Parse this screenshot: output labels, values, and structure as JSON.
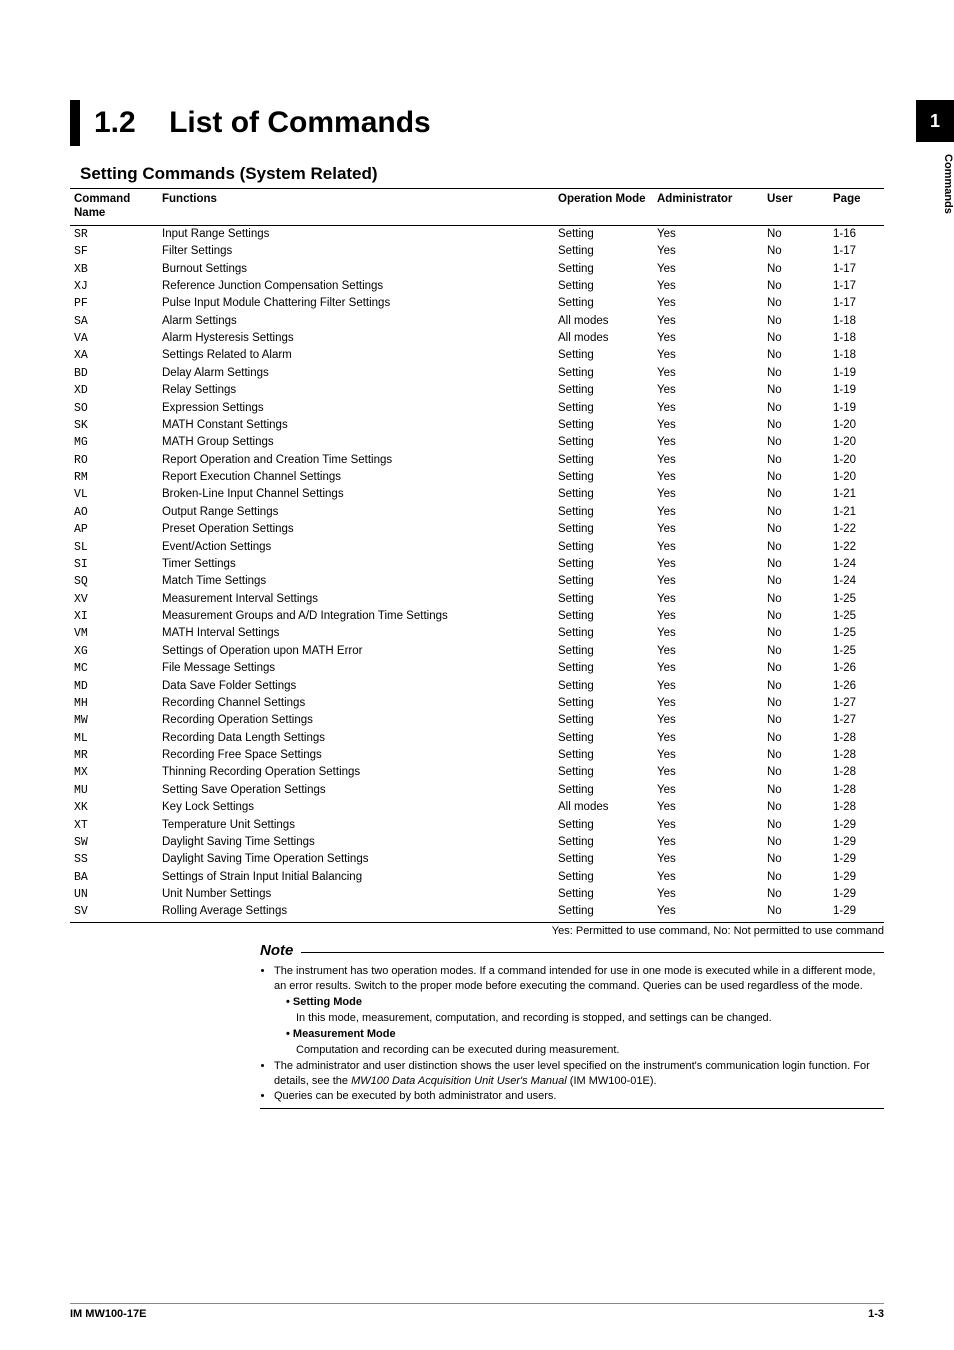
{
  "side_tab": "1",
  "side_label": "Commands",
  "section_num": "1.2",
  "section_title": "List of Commands",
  "subheading": "Setting Commands (System Related)",
  "th": {
    "cmd": "Command Name",
    "func": "Functions",
    "opmode": "Operation Mode",
    "admin": "Administrator",
    "user": "User",
    "page": "Page"
  },
  "rows": [
    {
      "cmd": "SR",
      "func": "Input Range Settings",
      "opmode": "Setting",
      "admin": "Yes",
      "user": "No",
      "page": "1-16"
    },
    {
      "cmd": "SF",
      "func": "Filter Settings",
      "opmode": "Setting",
      "admin": "Yes",
      "user": "No",
      "page": "1-17"
    },
    {
      "cmd": "XB",
      "func": "Burnout Settings",
      "opmode": "Setting",
      "admin": "Yes",
      "user": "No",
      "page": "1-17"
    },
    {
      "cmd": "XJ",
      "func": "Reference Junction Compensation Settings",
      "opmode": "Setting",
      "admin": "Yes",
      "user": "No",
      "page": "1-17"
    },
    {
      "cmd": "PF",
      "func": "Pulse Input Module Chattering Filter Settings",
      "opmode": "Setting",
      "admin": "Yes",
      "user": "No",
      "page": "1-17"
    },
    {
      "cmd": "SA",
      "func": "Alarm Settings",
      "opmode": "All modes",
      "admin": "Yes",
      "user": "No",
      "page": "1-18"
    },
    {
      "cmd": "VA",
      "func": "Alarm Hysteresis Settings",
      "opmode": "All modes",
      "admin": "Yes",
      "user": "No",
      "page": "1-18"
    },
    {
      "cmd": "XA",
      "func": "Settings Related to Alarm",
      "opmode": "Setting",
      "admin": "Yes",
      "user": "No",
      "page": "1-18"
    },
    {
      "cmd": "BD",
      "func": "Delay Alarm Settings",
      "opmode": "Setting",
      "admin": "Yes",
      "user": "No",
      "page": "1-19"
    },
    {
      "cmd": "XD",
      "func": "Relay Settings",
      "opmode": "Setting",
      "admin": "Yes",
      "user": "No",
      "page": "1-19"
    },
    {
      "cmd": "SO",
      "func": "Expression Settings",
      "opmode": "Setting",
      "admin": "Yes",
      "user": "No",
      "page": "1-19"
    },
    {
      "cmd": "SK",
      "func": "MATH Constant Settings",
      "opmode": "Setting",
      "admin": "Yes",
      "user": "No",
      "page": "1-20"
    },
    {
      "cmd": "MG",
      "func": "MATH Group Settings",
      "opmode": "Setting",
      "admin": "Yes",
      "user": "No",
      "page": "1-20"
    },
    {
      "cmd": "RO",
      "func": "Report Operation and Creation Time Settings",
      "opmode": "Setting",
      "admin": "Yes",
      "user": "No",
      "page": "1-20"
    },
    {
      "cmd": "RM",
      "func": "Report Execution Channel Settings",
      "opmode": "Setting",
      "admin": "Yes",
      "user": "No",
      "page": "1-20"
    },
    {
      "cmd": "VL",
      "func": "Broken-Line Input Channel Settings",
      "opmode": "Setting",
      "admin": "Yes",
      "user": "No",
      "page": "1-21"
    },
    {
      "cmd": "AO",
      "func": "Output Range Settings",
      "opmode": "Setting",
      "admin": "Yes",
      "user": "No",
      "page": "1-21"
    },
    {
      "cmd": "AP",
      "func": "Preset Operation Settings",
      "opmode": "Setting",
      "admin": "Yes",
      "user": "No",
      "page": "1-22"
    },
    {
      "cmd": "SL",
      "func": "Event/Action Settings",
      "opmode": "Setting",
      "admin": "Yes",
      "user": "No",
      "page": "1-22"
    },
    {
      "cmd": "SI",
      "func": "Timer Settings",
      "opmode": "Setting",
      "admin": "Yes",
      "user": "No",
      "page": "1-24"
    },
    {
      "cmd": "SQ",
      "func": "Match Time Settings",
      "opmode": "Setting",
      "admin": "Yes",
      "user": "No",
      "page": "1-24"
    },
    {
      "cmd": "XV",
      "func": "Measurement Interval Settings",
      "opmode": "Setting",
      "admin": "Yes",
      "user": "No",
      "page": "1-25"
    },
    {
      "cmd": "XI",
      "func": "Measurement Groups and A/D Integration Time Settings",
      "opmode": "Setting",
      "admin": "Yes",
      "user": "No",
      "page": "1-25"
    },
    {
      "cmd": "VM",
      "func": "MATH Interval Settings",
      "opmode": "Setting",
      "admin": "Yes",
      "user": "No",
      "page": "1-25"
    },
    {
      "cmd": "XG",
      "func": "Settings of Operation upon MATH Error",
      "opmode": "Setting",
      "admin": "Yes",
      "user": "No",
      "page": "1-25"
    },
    {
      "cmd": "MC",
      "func": "File Message Settings",
      "opmode": "Setting",
      "admin": "Yes",
      "user": "No",
      "page": "1-26"
    },
    {
      "cmd": "MD",
      "func": "Data Save Folder Settings",
      "opmode": "Setting",
      "admin": "Yes",
      "user": "No",
      "page": "1-26"
    },
    {
      "cmd": "MH",
      "func": "Recording Channel Settings",
      "opmode": "Setting",
      "admin": "Yes",
      "user": "No",
      "page": "1-27"
    },
    {
      "cmd": "MW",
      "func": "Recording Operation Settings",
      "opmode": "Setting",
      "admin": "Yes",
      "user": "No",
      "page": "1-27"
    },
    {
      "cmd": "ML",
      "func": "Recording Data Length Settings",
      "opmode": "Setting",
      "admin": "Yes",
      "user": "No",
      "page": "1-28"
    },
    {
      "cmd": "MR",
      "func": "Recording Free Space Settings",
      "opmode": "Setting",
      "admin": "Yes",
      "user": "No",
      "page": "1-28"
    },
    {
      "cmd": "MX",
      "func": "Thinning Recording Operation Settings",
      "opmode": "Setting",
      "admin": "Yes",
      "user": "No",
      "page": "1-28"
    },
    {
      "cmd": "MU",
      "func": "Setting Save Operation Settings",
      "opmode": "Setting",
      "admin": "Yes",
      "user": "No",
      "page": "1-28"
    },
    {
      "cmd": "XK",
      "func": "Key Lock Settings",
      "opmode": "All modes",
      "admin": "Yes",
      "user": "No",
      "page": "1-28"
    },
    {
      "cmd": "XT",
      "func": "Temperature Unit Settings",
      "opmode": "Setting",
      "admin": "Yes",
      "user": "No",
      "page": "1-29"
    },
    {
      "cmd": "SW",
      "func": "Daylight Saving Time Settings",
      "opmode": "Setting",
      "admin": "Yes",
      "user": "No",
      "page": "1-29"
    },
    {
      "cmd": "SS",
      "func": "Daylight Saving Time Operation Settings",
      "opmode": "Setting",
      "admin": "Yes",
      "user": "No",
      "page": "1-29"
    },
    {
      "cmd": "BA",
      "func": "Settings of Strain Input Initial Balancing",
      "opmode": "Setting",
      "admin": "Yes",
      "user": "No",
      "page": "1-29"
    },
    {
      "cmd": "UN",
      "func": "Unit Number Settings",
      "opmode": "Setting",
      "admin": "Yes",
      "user": "No",
      "page": "1-29"
    },
    {
      "cmd": "SV",
      "func": "Rolling Average Settings",
      "opmode": "Setting",
      "admin": "Yes",
      "user": "No",
      "page": "1-29"
    }
  ],
  "legend": "Yes: Permitted to use command, No: Not permitted to use command",
  "note": {
    "heading": "Note",
    "items": [
      "The instrument has two operation modes. If a command intended for use in one mode is executed while in a different mode, an error results. Switch to the proper mode before executing the command. Queries can be used regardless of the mode.",
      "The administrator and user distinction shows the user level specified on the instrument's communication login function. For details, see the MW100 Data Acquisition Unit User's Manual (IM MW100-01E).",
      "Queries can be executed by both administrator and users."
    ],
    "modes": [
      {
        "title": "• Setting Mode",
        "desc": "In this mode, measurement, computation, and recording is stopped, and settings can be changed."
      },
      {
        "title": "• Measurement Mode",
        "desc": "Computation and recording can be executed during measurement."
      }
    ],
    "item2_pre": "The administrator and user distinction shows the user level specified on the instrument's communication login function. For details, see the ",
    "item2_it": "MW100 Data Acquisition Unit User's Manual",
    "item2_post": " (IM MW100-01E)."
  },
  "footer": {
    "left": "IM MW100-17E",
    "right": "1-3"
  }
}
